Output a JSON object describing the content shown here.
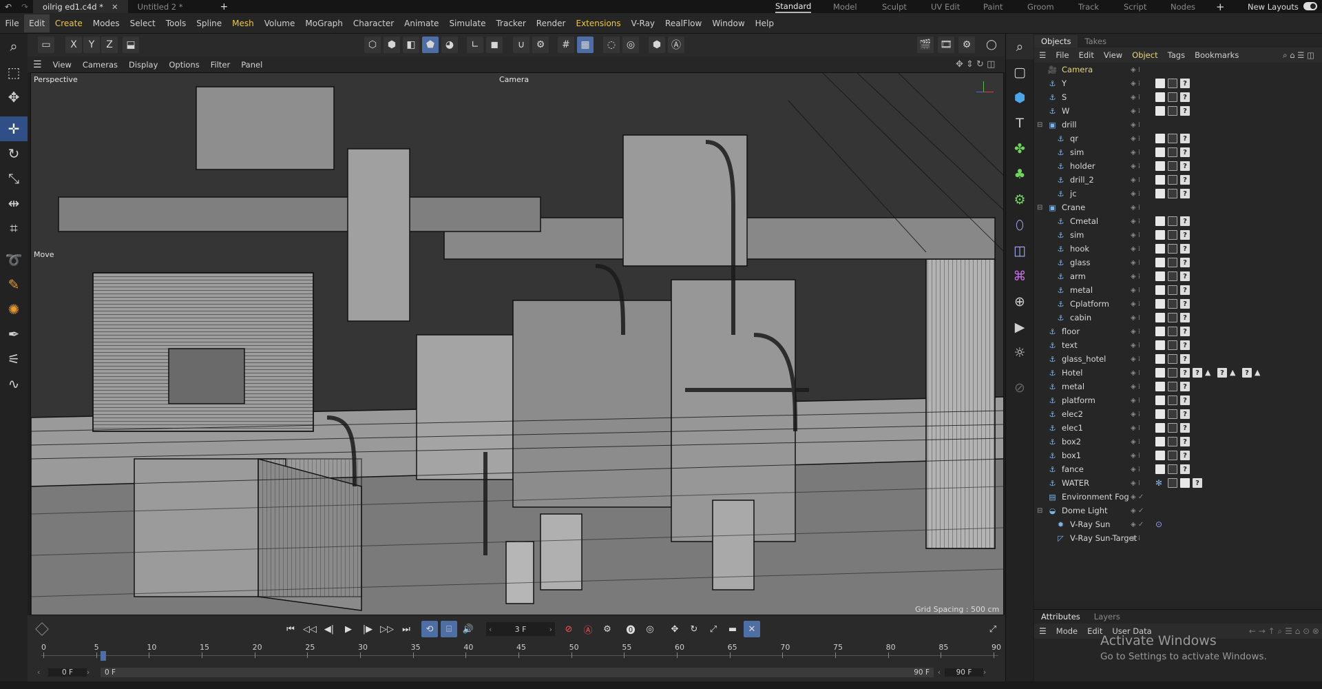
{
  "titlebar": {
    "tabs": [
      {
        "label": "oilrig ed1.c4d *",
        "active": true
      },
      {
        "label": "Untitled 2 *",
        "active": false
      }
    ],
    "layouts": [
      {
        "label": "Standard",
        "active": true
      },
      {
        "label": "Model"
      },
      {
        "label": "Sculpt"
      },
      {
        "label": "UV Edit"
      },
      {
        "label": "Paint"
      },
      {
        "label": "Groom"
      },
      {
        "label": "Track"
      },
      {
        "label": "Script"
      },
      {
        "label": "Nodes"
      }
    ],
    "new_layouts": "New Layouts"
  },
  "menubar": [
    "File",
    "Edit",
    "Create",
    "Modes",
    "Select",
    "Tools",
    "Spline",
    "Mesh",
    "Volume",
    "MoGraph",
    "Character",
    "Animate",
    "Simulate",
    "Tracker",
    "Render",
    "Extensions",
    "V-Ray",
    "RealFlow",
    "Window",
    "Help"
  ],
  "viewport": {
    "menu": [
      "View",
      "Cameras",
      "Display",
      "Options",
      "Filter",
      "Panel"
    ],
    "name": "Perspective",
    "camera": "Camera",
    "tool_label": "Move",
    "grid_spacing": "Grid Spacing : 500 cm"
  },
  "objects": {
    "tabs": [
      "Objects",
      "Takes"
    ],
    "menu": [
      "File",
      "Edit",
      "View",
      "Object",
      "Tags",
      "Bookmarks"
    ],
    "items": [
      {
        "name": "Camera",
        "indent": 0,
        "icon": "camera-icon",
        "glyph": "🎥",
        "hl": true
      },
      {
        "name": "Y",
        "indent": 0,
        "icon": "null-icon",
        "glyph": "⚓",
        "tags": [
          "t",
          "d",
          "q"
        ]
      },
      {
        "name": "S",
        "indent": 0,
        "icon": "null-icon",
        "glyph": "⚓",
        "tags": [
          "t",
          "d",
          "q"
        ]
      },
      {
        "name": "W",
        "indent": 0,
        "icon": "null-icon",
        "glyph": "⚓",
        "tags": [
          "t",
          "d",
          "q"
        ]
      },
      {
        "name": "drill",
        "indent": 0,
        "icon": "null-icon",
        "glyph": "▣",
        "expand": "⊟"
      },
      {
        "name": "qr",
        "indent": 1,
        "icon": "null-icon",
        "glyph": "⚓",
        "tags": [
          "t",
          "d",
          "q"
        ]
      },
      {
        "name": "sim",
        "indent": 1,
        "icon": "null-icon",
        "glyph": "⚓",
        "tags": [
          "t",
          "d",
          "q"
        ]
      },
      {
        "name": "holder",
        "indent": 1,
        "icon": "null-icon",
        "glyph": "⚓",
        "tags": [
          "t",
          "d",
          "q"
        ]
      },
      {
        "name": "drill_2",
        "indent": 1,
        "icon": "null-icon",
        "glyph": "⚓",
        "tags": [
          "t",
          "d",
          "q"
        ]
      },
      {
        "name": "jc",
        "indent": 1,
        "icon": "null-icon",
        "glyph": "⚓",
        "tags": [
          "t",
          "d",
          "q"
        ]
      },
      {
        "name": "Crane",
        "indent": 0,
        "icon": "null-icon",
        "glyph": "▣",
        "expand": "⊟"
      },
      {
        "name": "Cmetal",
        "indent": 1,
        "icon": "null-icon",
        "glyph": "⚓",
        "tags": [
          "t",
          "d",
          "q"
        ]
      },
      {
        "name": "sim",
        "indent": 1,
        "icon": "null-icon",
        "glyph": "⚓",
        "tags": [
          "t",
          "d",
          "q"
        ]
      },
      {
        "name": "hook",
        "indent": 1,
        "icon": "null-icon",
        "glyph": "⚓",
        "tags": [
          "t",
          "d",
          "q"
        ]
      },
      {
        "name": "glass",
        "indent": 1,
        "icon": "null-icon",
        "glyph": "⚓",
        "tags": [
          "t",
          "d",
          "q"
        ]
      },
      {
        "name": "arm",
        "indent": 1,
        "icon": "null-icon",
        "glyph": "⚓",
        "tags": [
          "t",
          "d",
          "q"
        ]
      },
      {
        "name": "metal",
        "indent": 1,
        "icon": "null-icon",
        "glyph": "⚓",
        "tags": [
          "t",
          "d",
          "q"
        ]
      },
      {
        "name": "Cplatform",
        "indent": 1,
        "icon": "null-icon",
        "glyph": "⚓",
        "tags": [
          "t",
          "d",
          "q"
        ]
      },
      {
        "name": "cabin",
        "indent": 1,
        "icon": "null-icon",
        "glyph": "⚓",
        "tags": [
          "t",
          "d",
          "q"
        ]
      },
      {
        "name": "floor",
        "indent": 0,
        "icon": "null-icon",
        "glyph": "⚓",
        "tags": [
          "t",
          "d",
          "q"
        ]
      },
      {
        "name": "text",
        "indent": 0,
        "icon": "null-icon",
        "glyph": "⚓",
        "tags": [
          "t",
          "d",
          "q"
        ]
      },
      {
        "name": "glass_hotel",
        "indent": 0,
        "icon": "null-icon",
        "glyph": "⚓",
        "tags": [
          "t",
          "d",
          "q"
        ]
      },
      {
        "name": "Hotel",
        "indent": 0,
        "icon": "null-icon",
        "glyph": "⚓",
        "tags": [
          "t",
          "d",
          "q",
          "q",
          "a",
          "q",
          "a",
          "q",
          "a"
        ]
      },
      {
        "name": "metal",
        "indent": 0,
        "icon": "null-icon",
        "glyph": "⚓",
        "tags": [
          "t",
          "d",
          "q"
        ]
      },
      {
        "name": "platform",
        "indent": 0,
        "icon": "null-icon",
        "glyph": "⚓",
        "tags": [
          "t",
          "d",
          "q"
        ]
      },
      {
        "name": "elec2",
        "indent": 0,
        "icon": "null-icon",
        "glyph": "⚓",
        "tags": [
          "t",
          "d",
          "q"
        ]
      },
      {
        "name": "elec1",
        "indent": 0,
        "icon": "null-icon",
        "glyph": "⚓",
        "tags": [
          "t",
          "d",
          "q"
        ]
      },
      {
        "name": "box2",
        "indent": 0,
        "icon": "null-icon",
        "glyph": "⚓",
        "tags": [
          "t",
          "d",
          "q"
        ]
      },
      {
        "name": "box1",
        "indent": 0,
        "icon": "null-icon",
        "glyph": "⚓",
        "tags": [
          "t",
          "d",
          "q"
        ]
      },
      {
        "name": "fance",
        "indent": 0,
        "icon": "null-icon",
        "glyph": "⚓",
        "tags": [
          "t",
          "d",
          "q"
        ]
      },
      {
        "name": "WATER",
        "indent": 0,
        "icon": "null-icon",
        "glyph": "⚓",
        "tags": [
          "w",
          "d",
          "t",
          "q"
        ]
      },
      {
        "name": "Environment Fog",
        "indent": 0,
        "icon": "fog-icon",
        "glyph": "▤",
        "check": true
      },
      {
        "name": "Dome Light",
        "indent": 0,
        "icon": "dome-light-icon",
        "glyph": "◒",
        "expand": "⊟",
        "check": true
      },
      {
        "name": "V-Ray Sun",
        "indent": 1,
        "icon": "sun-icon",
        "glyph": "✹",
        "check": true,
        "target": true
      },
      {
        "name": "V-Ray Sun-Target",
        "indent": 1,
        "icon": "target-icon",
        "glyph": "◸"
      }
    ]
  },
  "attributes": {
    "tabs": [
      "Attributes",
      "Layers"
    ],
    "menu": [
      "Mode",
      "Edit",
      "User Data"
    ]
  },
  "watermark": {
    "title": "Activate Windows",
    "subtitle": "Go to Settings to activate Windows."
  },
  "timeline": {
    "current_frame": "3 F",
    "ticks": [
      "0",
      "5",
      "10",
      "15",
      "20",
      "25",
      "30",
      "35",
      "40",
      "45",
      "50",
      "55",
      "60",
      "65",
      "70",
      "75",
      "80",
      "85",
      "90"
    ],
    "start": "0 F",
    "range_start": "0 F",
    "range_end": "90 F",
    "end": "90 F"
  },
  "colors": {
    "accent": "#4e6ea6",
    "menu_highlight": "#f0c93a",
    "camera_text": "#e6d77a"
  }
}
